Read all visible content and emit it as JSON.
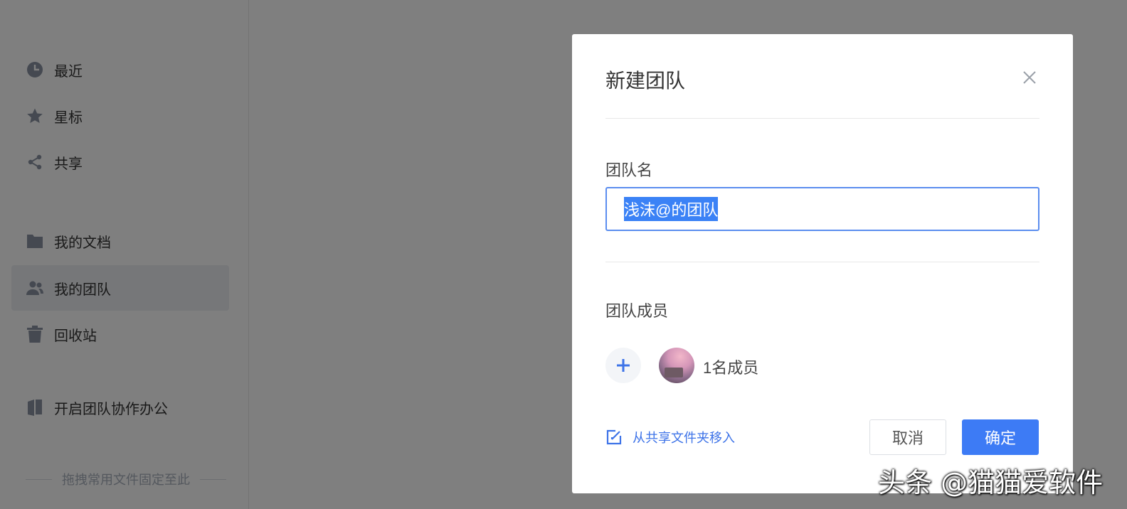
{
  "sidebar": {
    "items": [
      {
        "label": "最近",
        "icon": "clock-icon"
      },
      {
        "label": "星标",
        "icon": "star-icon"
      },
      {
        "label": "共享",
        "icon": "share-icon"
      },
      {
        "label": "我的文档",
        "icon": "folder-icon"
      },
      {
        "label": "我的团队",
        "icon": "team-icon",
        "active": true
      },
      {
        "label": "回收站",
        "icon": "trash-icon"
      },
      {
        "label": "开启团队协作办公",
        "icon": "book-icon"
      }
    ],
    "pin_hint": "拖拽常用文件固定至此"
  },
  "dialog": {
    "title": "新建团队",
    "team_name_label": "团队名",
    "team_name_value": "浅沫@的团队",
    "members_label": "团队成员",
    "member_count": "1名成员",
    "move_link": "从共享文件夹移入",
    "cancel_label": "取消",
    "confirm_label": "确定"
  },
  "watermark": "头条 @猫猫爱软件",
  "colors": {
    "accent": "#3d7bf5",
    "overlay": "rgba(0,0,0,0.5)",
    "active_item_bg": "#eceef2"
  }
}
